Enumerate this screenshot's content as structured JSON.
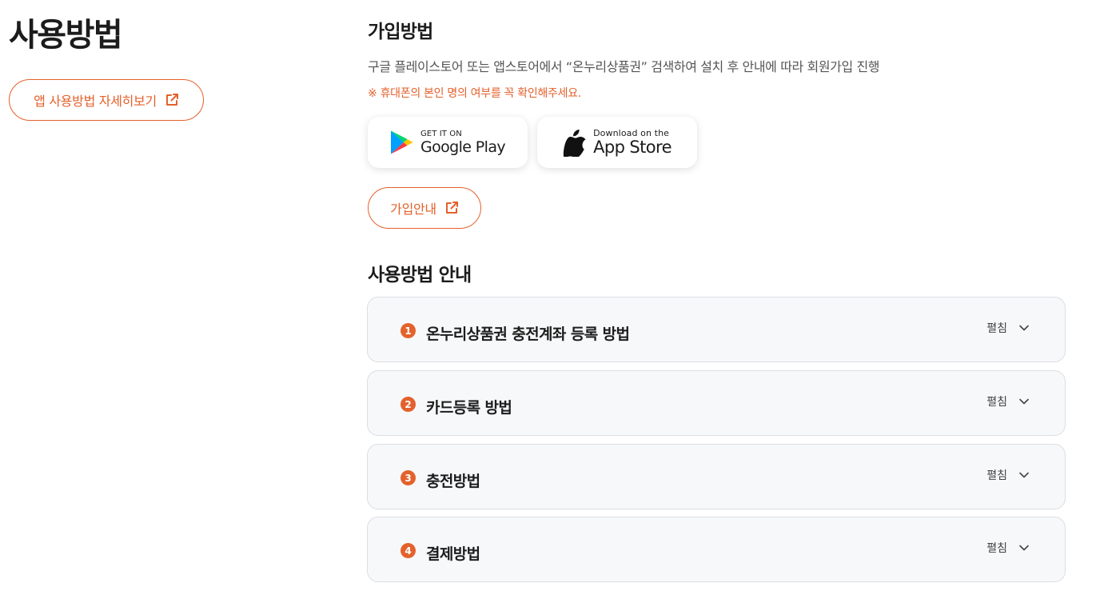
{
  "page_title": "사용방법",
  "app_guide_button": {
    "label": "앱 사용방법 자세히보기",
    "icon": "external-link-icon"
  },
  "signup": {
    "title": "가입방법",
    "description": "구글 플레이스토어 또는 앱스토어에서 “온누리상품권” 검색하여 설치 후 안내에 따라 회원가입 진행",
    "notice": "※ 휴대폰의 본인 명의 여부를 꼭 확인해주세요.",
    "google_play": {
      "small": "GET IT ON",
      "big": "Google Play",
      "icon": "google-play-icon"
    },
    "app_store": {
      "small": "Download on the",
      "big": "App Store",
      "icon": "apple-icon"
    },
    "signup_button": {
      "label": "가입안내",
      "icon": "external-link-icon"
    }
  },
  "usage": {
    "title": "사용방법 안내",
    "items": [
      {
        "number": "1",
        "title": "온누리상품권 충전계좌 등록 방법",
        "toggle": "펼침"
      },
      {
        "number": "2",
        "title": "카드등록 방법",
        "toggle": "펼침"
      },
      {
        "number": "3",
        "title": "충전방법",
        "toggle": "펼침"
      },
      {
        "number": "4",
        "title": "결제방법",
        "toggle": "펼침"
      }
    ]
  },
  "colors": {
    "accent": "#e4612c",
    "text": "#1c1c1c",
    "card_bg": "#f7f8fa",
    "card_border": "#dcdee2"
  }
}
